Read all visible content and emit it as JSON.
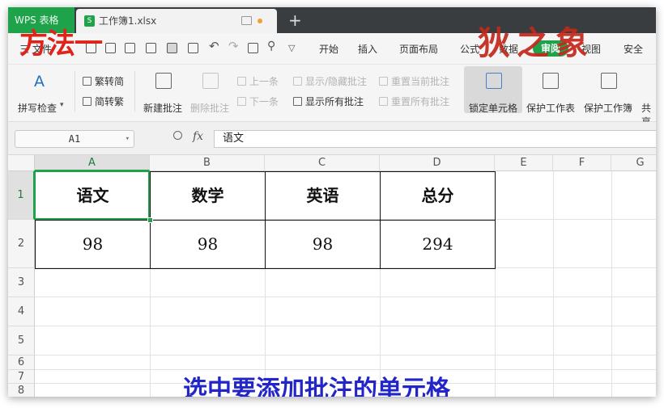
{
  "titlebar": {
    "app_tab": "WPS 表格",
    "file_name": "工作簿1.xlsx",
    "new_tab": "+"
  },
  "menu": {
    "file_menu": "三 文件",
    "tabs": [
      "开始",
      "插入",
      "页面布局",
      "公式",
      "数据",
      "审阅",
      "视图",
      "安全"
    ],
    "active_tab": "审阅"
  },
  "ribbon": {
    "spellcheck": "拼写检查",
    "trad_to_simp": "繁转简",
    "simp_to_trad": "简转繁",
    "new_comment": "新建批注",
    "delete_comment": "删除批注",
    "prev_comment": "上一条",
    "next_comment": "下一条",
    "show_hide_comment": "显示/隐藏批注",
    "show_all_comments": "显示所有批注",
    "reset_current_comment": "重置当前批注",
    "reset_all_comments": "重置所有批注",
    "lock_cell": "锁定单元格",
    "protect_sheet": "保护工作表",
    "protect_workbook": "保护工作簿",
    "share_workbook": "共享"
  },
  "formula_bar": {
    "name_box": "A1",
    "fx": "fx",
    "content": "语文"
  },
  "sheet": {
    "columns": [
      "A",
      "B",
      "C",
      "D",
      "E",
      "F",
      "G"
    ],
    "active_column": "A",
    "rows": [
      "1",
      "2",
      "3",
      "4",
      "5",
      "6",
      "7",
      "8"
    ],
    "active_row": "1",
    "header_row": [
      "语文",
      "数学",
      "英语",
      "总分"
    ],
    "data_row": [
      "98",
      "98",
      "98",
      "294"
    ]
  },
  "overlay": {
    "title": "方法一",
    "logo": "狄之象",
    "caption": "选中要添加批注的单元格"
  },
  "colors": {
    "accent": "#1fa34a",
    "overlay_red": "#e0231a",
    "caption_blue": "#2226c8"
  }
}
